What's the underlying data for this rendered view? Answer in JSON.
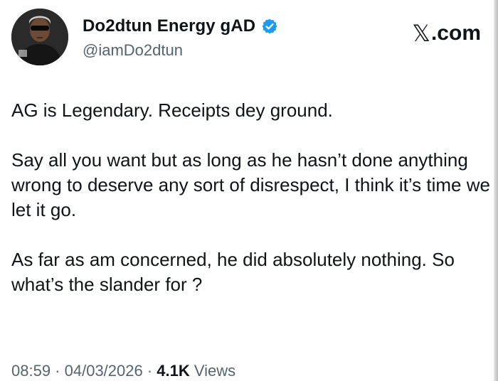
{
  "author": {
    "display_name": "Do2dtun Energy gAD",
    "handle": "@iamDo2dtun",
    "verified": true,
    "avatar_icon": "profile-photo-avatar"
  },
  "brand": {
    "x_glyph": "𝕏",
    "suffix": ".com"
  },
  "tweet": {
    "paragraphs": [
      "AG is Legendary. Receipts dey ground.",
      "Say all you want but as long as he hasn’t done anything wrong to deserve any sort of disrespect, I think it’s time we let it go.",
      "As far as am concerned, he did absolutely nothing. So what’s the slander for ?"
    ]
  },
  "meta": {
    "time": "08:59",
    "sep": " · ",
    "date": "04/03/2026",
    "views_count": "4.1K",
    "views_label": " Views"
  },
  "colors": {
    "text": "#0f1419",
    "secondary": "#536471",
    "verified_badge": "#1d9bf0"
  }
}
